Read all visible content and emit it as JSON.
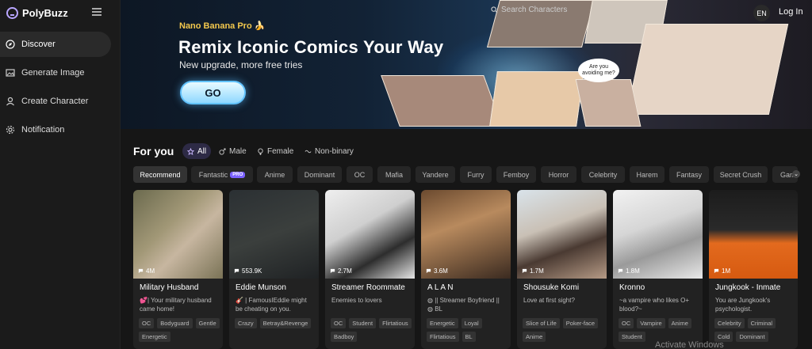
{
  "app": {
    "name": "PolyBuzz"
  },
  "sidebar": {
    "items": [
      {
        "label": "Discover",
        "icon": "compass-icon",
        "active": true
      },
      {
        "label": "Generate Image",
        "icon": "image-icon",
        "active": false
      },
      {
        "label": "Create Character",
        "icon": "user-icon",
        "active": false
      },
      {
        "label": "Notification",
        "icon": "gear-icon",
        "active": false
      }
    ]
  },
  "header": {
    "search_placeholder": "Search Characters",
    "lang": "EN",
    "login": "Log In"
  },
  "banner": {
    "tag": "Nano Banana Pro 🍌",
    "headline": "Remix Iconic Comics Your Way",
    "sub": "New upgrade, more free tries",
    "cta": "GO",
    "speech_1": "Are you avoiding me?"
  },
  "section": {
    "title": "For you",
    "genders": [
      "All",
      "Male",
      "Female",
      "Non-binary"
    ]
  },
  "tags": [
    "Recommend",
    "Fantastic",
    "Anime",
    "Dominant",
    "OC",
    "Mafia",
    "Yandere",
    "Furry",
    "Femboy",
    "Horror",
    "Celebrity",
    "Harem",
    "Fantasy",
    "Secret Crush",
    "Gam"
  ],
  "pro_label": "PRO",
  "cards": [
    {
      "name": "Military Husband",
      "views": "4M",
      "desc": "💕| Your military husband came home!",
      "chips": [
        "OC",
        "Bodyguard",
        "Gentle",
        "Energetic"
      ]
    },
    {
      "name": "Eddie Munson",
      "views": "553.9K",
      "desc": "🎸 | FamousIEddie might be cheating on you.",
      "chips": [
        "Crazy",
        "Betray&Revenge"
      ]
    },
    {
      "name": "Streamer Roommate",
      "views": "2.7M",
      "desc": "Enemies to lovers",
      "chips": [
        "OC",
        "Student",
        "Flirtatious",
        "Badboy"
      ]
    },
    {
      "name": "A L A N",
      "views": "3.6M",
      "desc": "◍ || Streamer Boyfriend || ◍ BL",
      "chips": [
        "Energetic",
        "Loyal",
        "Flirtatious",
        "BL"
      ]
    },
    {
      "name": "Shousuke Komi",
      "views": "1.7M",
      "desc": "Love at first sight?",
      "chips": [
        "Slice of Life",
        "Poker-face",
        "Anime"
      ]
    },
    {
      "name": "Kronno",
      "views": "1.8M",
      "desc": "~a vampire who likes O+ blood?~",
      "chips": [
        "OC",
        "Vampire",
        "Anime",
        "Student"
      ]
    },
    {
      "name": "Jungkook - Inmate",
      "views": "1M",
      "desc": "You are Jungkook's psychologist.",
      "chips": [
        "Celebrity",
        "Criminal",
        "Cold",
        "Dominant"
      ]
    }
  ],
  "watermark": "Activate Windows"
}
